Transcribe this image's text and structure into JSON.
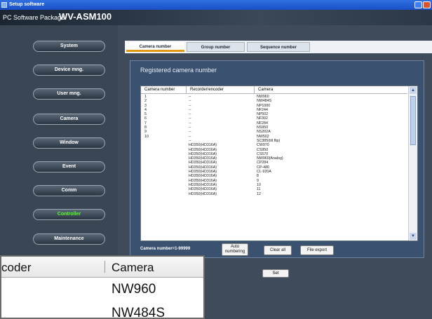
{
  "window": {
    "title": "Setup software"
  },
  "header": {
    "package_label": "PC Software Package",
    "model": "WV-ASM100"
  },
  "sidebar": {
    "items": [
      {
        "label": "System"
      },
      {
        "label": "Device mng."
      },
      {
        "label": "User mng."
      },
      {
        "label": "Camera"
      },
      {
        "label": "Window"
      },
      {
        "label": "Event"
      },
      {
        "label": "Comm"
      },
      {
        "label": "Controller",
        "active": true
      },
      {
        "label": "Maintenance"
      }
    ]
  },
  "tabs": [
    {
      "label": "Camera number",
      "active": true
    },
    {
      "label": "Group number"
    },
    {
      "label": "Sequence number"
    }
  ],
  "panel": {
    "title": "Registered camera number",
    "columns": [
      "Camera number",
      "Recorder/encoder",
      "Camera"
    ],
    "rows": [
      [
        "1",
        "--",
        "NW960"
      ],
      [
        "2",
        "--",
        "NW484S"
      ],
      [
        "3",
        "--",
        "NP1000"
      ],
      [
        "4",
        "--",
        "NF244"
      ],
      [
        "5",
        "--",
        "NP502"
      ],
      [
        "6",
        "--",
        "NF302"
      ],
      [
        "7",
        "--",
        "NF284"
      ],
      [
        "8",
        "--",
        "NS950"
      ],
      [
        "9",
        "--",
        "NS202A"
      ],
      [
        "10",
        "--",
        "NW502"
      ],
      [
        "",
        "--",
        "SC385(tilt flip)"
      ],
      [
        "",
        "HD350(HD316A)",
        "CW970"
      ],
      [
        "",
        "HD350(HD316A)",
        "CS950"
      ],
      [
        "",
        "HD350(HD316A)",
        "CS570"
      ],
      [
        "",
        "HD350(HD316A)",
        "NW960(Analog)"
      ],
      [
        "",
        "HD350(HD316A)",
        "CP284"
      ],
      [
        "",
        "HD350(HD316A)",
        "CP-480"
      ],
      [
        "",
        "HD350(HD316A)",
        "CL-920A"
      ],
      [
        "",
        "HD350(HD316A)",
        "8"
      ],
      [
        "",
        "HD350(HD316A)",
        "9"
      ],
      [
        "",
        "HD350(HD316A)",
        "10"
      ],
      [
        "",
        "HD350(HD316A)",
        "11"
      ],
      [
        "",
        "HD350(HD316A)",
        "12"
      ]
    ],
    "count_label": "Camera number=1-99999",
    "buttons": {
      "auto_line1": "Auto",
      "auto_line2": "numbering",
      "clear_all": "Clear all",
      "file_export": "File export"
    }
  },
  "footer": {
    "set_label": "Set"
  },
  "zoom_callout": {
    "header_left": "coder",
    "header_right": "Camera",
    "value1": "NW960",
    "value2": "NW484S"
  },
  "colors": {
    "active_nav": "#56ff2a",
    "tab_accent": "#e39a10",
    "titlebar": "#2f6fe0"
  }
}
